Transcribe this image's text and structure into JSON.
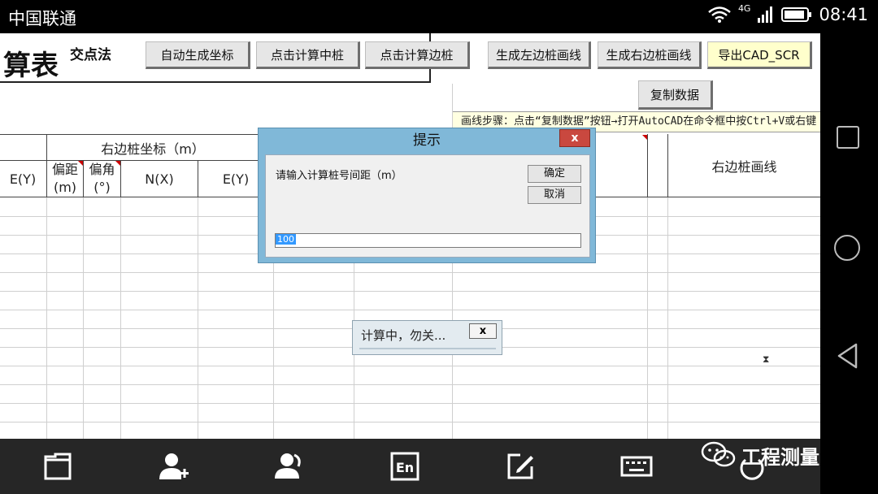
{
  "status_bar": {
    "carrier": "中国联通",
    "network": "4G",
    "time": "08:41"
  },
  "sheet": {
    "title": "算表",
    "subtitle": "交点法",
    "toolbar": {
      "auto_coords": "自动生成坐标",
      "calc_center": "点击计算中桩",
      "calc_side": "点击计算边桩",
      "gen_left": "生成左边桩画线",
      "gen_right": "生成右边桩画线",
      "export_cad": "导出CAD_SCR",
      "copy_data": "复制数据"
    },
    "note": "画线步骤：点击“复制数据”按钮→打开AutoCAD在命令框中按Ctrl+V或右键",
    "headers": {
      "group_right": "右边桩坐标（m）",
      "col_ey_left": "E(Y)",
      "col_offset_line1": "偏距",
      "col_offset_line2": "(m)",
      "col_angle_line1": "偏角",
      "col_angle_line2": "(°)",
      "col_nx": "N(X)",
      "col_ey": "E(Y)",
      "right_line": "右边桩画线"
    }
  },
  "dialog": {
    "title": "提示",
    "close_label": "x",
    "prompt": "请输入计算桩号间距（m）",
    "ok_label": "确定",
    "cancel_label": "取消",
    "input_value": "100"
  },
  "busy": {
    "text": "计算中，勿关...",
    "close_label": "x"
  },
  "bottom_bar": {
    "icons": [
      "folder-icon",
      "add-contact-icon",
      "contacts-icon",
      "en-input-icon",
      "edit-icon",
      "keyboard-icon"
    ]
  },
  "watermark": {
    "text": "工程测量员"
  }
}
